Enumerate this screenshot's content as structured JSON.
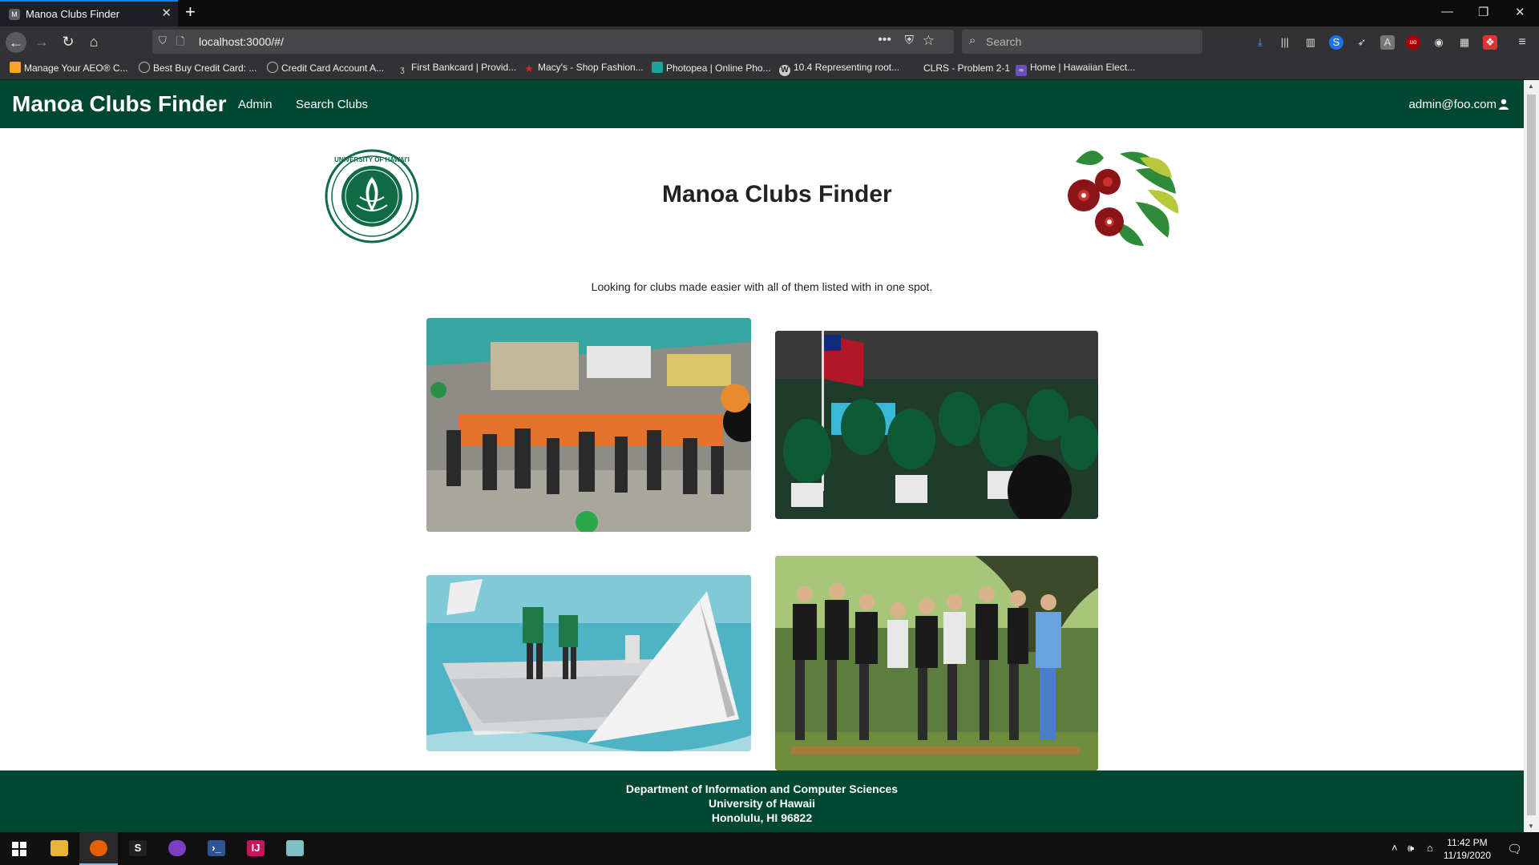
{
  "browser": {
    "tab_title": "Manoa Clubs Finder",
    "tab_favicon_letter": "M",
    "url": "localhost:3000/#/",
    "search_placeholder": "Search",
    "bookmarks": [
      {
        "label": "Manage Your AEO® C...",
        "icon": "aeo-icon",
        "color": "#f5a623"
      },
      {
        "label": "Best Buy Credit Card: ...",
        "icon": "globe-icon",
        "color": "#bbbbbb"
      },
      {
        "label": "Credit Card Account A...",
        "icon": "globe-icon",
        "color": "#bbbbbb"
      },
      {
        "label": "First Bankcard | Provid...",
        "icon": "bankcard-icon",
        "color": "#dddddd"
      },
      {
        "label": "Macy's - Shop Fashion...",
        "icon": "star-icon",
        "color": "#e0202f"
      },
      {
        "label": "Photopea | Online Pho...",
        "icon": "photopea-icon",
        "color": "#18a497"
      },
      {
        "label": "10.4 Representing root...",
        "icon": "wiki-icon",
        "color": "#bbbbbb"
      },
      {
        "label": "CLRS - Problem 2-1",
        "icon": "page-icon",
        "color": "#777777"
      },
      {
        "label": "Home | Hawaiian Elect...",
        "icon": "hawaiian-electric-icon",
        "color": "#6b4fbb"
      }
    ]
  },
  "app": {
    "brand": "Manoa Clubs Finder",
    "nav": [
      {
        "label": "Admin"
      },
      {
        "label": "Search Clubs"
      }
    ],
    "user_email": "admin@foo.com",
    "title": "Manoa Clubs Finder",
    "tagline": "Looking for clubs made easier with all of them listed with in one spot.",
    "seal_text": "UNIVERSITY OF HAWAI'I",
    "footer": {
      "line1": "Department of Information and Computer Sciences",
      "line2": "University of Hawaii",
      "line3": "Honolulu, HI 96822"
    },
    "colors": {
      "brand_green": "#024731",
      "hibiscus_red": "#8b1419",
      "leaf_green": "#2e8b3a"
    }
  },
  "taskbar": {
    "time": "11:42 PM",
    "date": "11/19/2020",
    "apps": [
      "windows-start-icon",
      "file-explorer-icon",
      "firefox-icon",
      "s-app-icon",
      "mail-app-icon",
      "powershell-icon",
      "intellij-icon",
      "notepad-icon"
    ]
  }
}
